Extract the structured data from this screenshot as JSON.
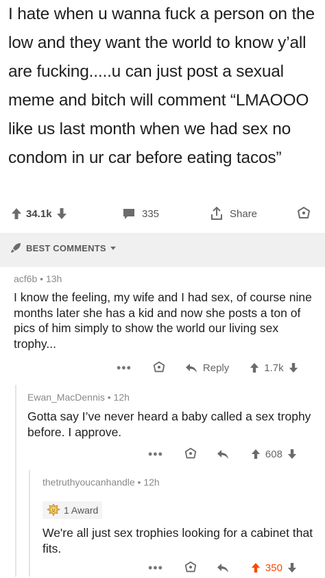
{
  "post": {
    "text": "I hate when u wanna fuck a person on the low and they want the world to know y’all are fucking.....u can just post a sexual meme and bitch will comment “LMAOOO like us last month when we had sex no condom in ur car before eating tacos”",
    "upvotes": "34.1k",
    "comments": "335",
    "share_label": "Share"
  },
  "best_comments_label": "BEST COMMENTS",
  "comments": [
    {
      "author": "acf6b",
      "time": "13h",
      "body": "I know the feeling, my wife and I had sex, of course nine months later she has a kid and now she posts a ton of pics of him simply to show the world our living sex trophy...",
      "reply_label": "Reply",
      "score": "1.7k"
    },
    {
      "author": "Ewan_MacDennis",
      "time": "12h",
      "body": "Gotta say I’ve never heard a baby called a sex trophy before. I approve.",
      "score": "608"
    },
    {
      "author": "thetruthyoucanhandle",
      "time": "12h",
      "award": "1 Award",
      "body": "We're all just sex trophies looking for a cabinet that fits.",
      "score": "350"
    }
  ],
  "colors": {
    "upvoted": "#ff4500",
    "muted": "#878a8c",
    "band": "#f0f0f0"
  }
}
